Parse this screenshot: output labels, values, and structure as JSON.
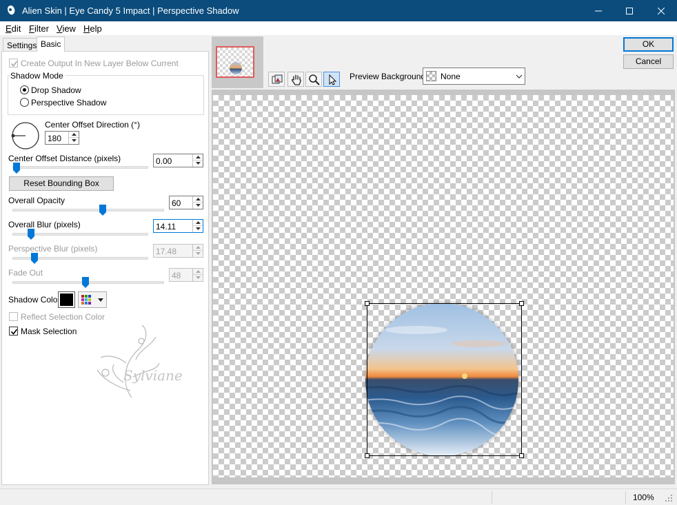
{
  "window": {
    "title": "Alien Skin | Eye Candy 5 Impact | Perspective Shadow",
    "icons": [
      "app-icon",
      "minimize-icon",
      "maximize-icon",
      "close-icon"
    ]
  },
  "menu": [
    {
      "accel": "E",
      "rest": "dit"
    },
    {
      "accel": "F",
      "rest": "ilter"
    },
    {
      "accel": "V",
      "rest": "iew"
    },
    {
      "accel": "H",
      "rest": "elp"
    }
  ],
  "tabs": {
    "settings": "Settings",
    "basic": "Basic"
  },
  "basic": {
    "create_output_label": "Create Output In New Layer Below Current",
    "shadow_mode": {
      "title": "Shadow Mode",
      "options": [
        "Drop Shadow",
        "Perspective Shadow"
      ],
      "selected": "Drop Shadow"
    },
    "center_offset_direction": {
      "label": "Center Offset Direction (°)",
      "value": "180"
    },
    "center_offset_distance": {
      "label": "Center Offset Distance (pixels)",
      "value": "0.00",
      "slider": 0.02
    },
    "reset_bounding_box": "Reset Bounding Box",
    "overall_opacity": {
      "label": "Overall Opacity",
      "value": "60",
      "slider": 0.6
    },
    "overall_blur": {
      "label": "Overall Blur (pixels)",
      "value": "14.11",
      "slider": 0.14
    },
    "perspective_blur": {
      "label": "Perspective Blur (pixels)",
      "value": "17.48",
      "slider": 0.17
    },
    "fade_out": {
      "label": "Fade Out",
      "value": "48",
      "slider": 0.48
    },
    "shadow_color": {
      "label": "Shadow Color",
      "color": "#000000"
    },
    "reflect_selection_color": {
      "label": "Reflect Selection Color",
      "checked": false
    },
    "mask_selection": {
      "label": "Mask Selection",
      "checked": true
    },
    "watermark": "Sylviane"
  },
  "buttons": {
    "ok": "OK",
    "cancel": "Cancel"
  },
  "toolbar": {
    "tools": [
      "preview-toggle-icon",
      "hand-icon",
      "zoom-icon",
      "arrow-icon"
    ],
    "preview_background_label": "Preview Background:",
    "preview_background_value": "None"
  },
  "status": {
    "zoom": "100%"
  },
  "colors": {
    "titlebar": "#0b4c7c",
    "accent": "#0078d7"
  }
}
